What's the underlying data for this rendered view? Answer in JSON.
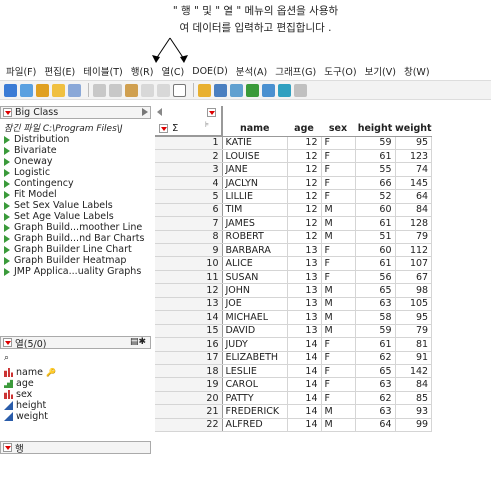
{
  "annotation": {
    "line1": "\" 행 \" 및 \" 열 \" 메뉴의 옵션을 사용하",
    "line2": "여 데이터를 입력하고 편집합니다 ."
  },
  "menu": [
    "파일(F)",
    "편집(E)",
    "테이블(T)",
    "행(R)",
    "열(C)",
    "DOE(D)",
    "분석(A)",
    "그래프(G)",
    "도구(O)",
    "보기(V)",
    "창(W)"
  ],
  "table_panel": {
    "title": "Big Class",
    "path": "잠긴 파일  C:\\Program Files\\J",
    "scripts": [
      "Distribution",
      "Bivariate",
      "Oneway",
      "Logistic",
      "Contingency",
      "Fit Model",
      "Set Sex Value Labels",
      "Set Age Value Labels",
      "Graph Build...moother Line",
      "Graph Build...nd Bar Charts",
      "Graph Builder Line Chart",
      "Graph Builder Heatmap",
      "JMP Applica...uality Graphs"
    ]
  },
  "columns_panel": {
    "title": "열(5/0)",
    "search_placeholder": "",
    "columns": [
      {
        "name": "name",
        "type": "nominal",
        "key": true
      },
      {
        "name": "age",
        "type": "ordinal"
      },
      {
        "name": "sex",
        "type": "nominal"
      },
      {
        "name": "height",
        "type": "continuous"
      },
      {
        "name": "weight",
        "type": "continuous"
      }
    ]
  },
  "rows_panel": {
    "title": "행"
  },
  "grid": {
    "headers": [
      "name",
      "age",
      "sex",
      "height",
      "weight"
    ],
    "rows": [
      [
        "1",
        "KATIE",
        "12",
        "F",
        "59",
        "95"
      ],
      [
        "2",
        "LOUISE",
        "12",
        "F",
        "61",
        "123"
      ],
      [
        "3",
        "JANE",
        "12",
        "F",
        "55",
        "74"
      ],
      [
        "4",
        "JACLYN",
        "12",
        "F",
        "66",
        "145"
      ],
      [
        "5",
        "LILLIE",
        "12",
        "F",
        "52",
        "64"
      ],
      [
        "6",
        "TIM",
        "12",
        "M",
        "60",
        "84"
      ],
      [
        "7",
        "JAMES",
        "12",
        "M",
        "61",
        "128"
      ],
      [
        "8",
        "ROBERT",
        "12",
        "M",
        "51",
        "79"
      ],
      [
        "9",
        "BARBARA",
        "13",
        "F",
        "60",
        "112"
      ],
      [
        "10",
        "ALICE",
        "13",
        "F",
        "61",
        "107"
      ],
      [
        "11",
        "SUSAN",
        "13",
        "F",
        "56",
        "67"
      ],
      [
        "12",
        "JOHN",
        "13",
        "M",
        "65",
        "98"
      ],
      [
        "13",
        "JOE",
        "13",
        "M",
        "63",
        "105"
      ],
      [
        "14",
        "MICHAEL",
        "13",
        "M",
        "58",
        "95"
      ],
      [
        "15",
        "DAVID",
        "13",
        "M",
        "59",
        "79"
      ],
      [
        "16",
        "JUDY",
        "14",
        "F",
        "61",
        "81"
      ],
      [
        "17",
        "ELIZABETH",
        "14",
        "F",
        "62",
        "91"
      ],
      [
        "18",
        "LESLIE",
        "14",
        "F",
        "65",
        "142"
      ],
      [
        "19",
        "CAROL",
        "14",
        "F",
        "63",
        "84"
      ],
      [
        "20",
        "PATTY",
        "14",
        "F",
        "62",
        "85"
      ],
      [
        "21",
        "FREDERICK",
        "14",
        "M",
        "63",
        "93"
      ],
      [
        "22",
        "ALFRED",
        "14",
        "M",
        "64",
        "99"
      ]
    ]
  }
}
